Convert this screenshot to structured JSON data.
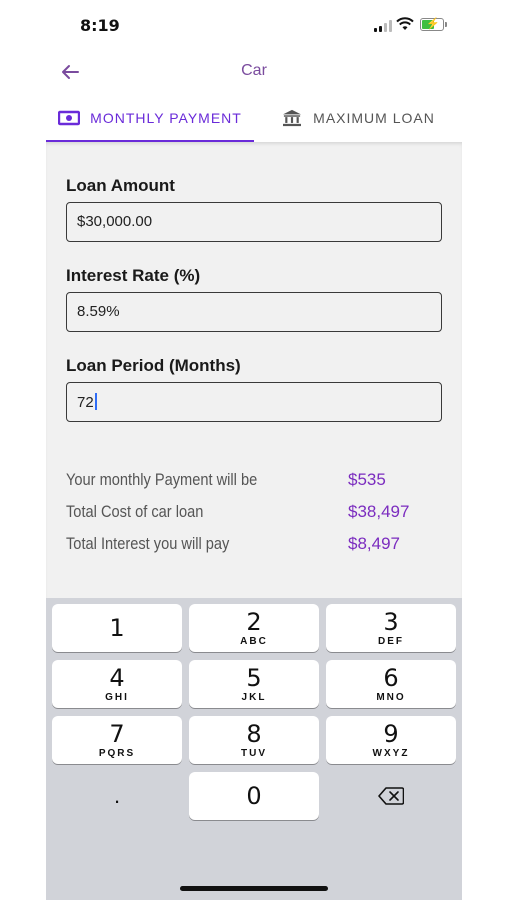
{
  "status": {
    "time": "8:19"
  },
  "nav": {
    "title": "Car"
  },
  "tabs": [
    {
      "label": "MONTHLY PAYMENT",
      "icon": "cash-icon",
      "active": true
    },
    {
      "label": "MAXIMUM LOAN",
      "icon": "bank-icon",
      "active": false
    }
  ],
  "form": {
    "loan_amount": {
      "label": "Loan Amount",
      "value": "$30,000.00"
    },
    "interest_rate": {
      "label": "Interest Rate (%)",
      "value": "8.59%"
    },
    "loan_period": {
      "label": "Loan Period (Months)",
      "value": "72"
    }
  },
  "results": [
    {
      "label": "Your monthly Payment will be",
      "value": "$535"
    },
    {
      "label": "Total Cost of car loan",
      "value": "$38,497"
    },
    {
      "label": "Total Interest you will pay",
      "value": "$8,497"
    }
  ],
  "keypad": {
    "keys": [
      {
        "num": "1",
        "letters": ""
      },
      {
        "num": "2",
        "letters": "ABC"
      },
      {
        "num": "3",
        "letters": "DEF"
      },
      {
        "num": "4",
        "letters": "GHI"
      },
      {
        "num": "5",
        "letters": "JKL"
      },
      {
        "num": "6",
        "letters": "MNO"
      },
      {
        "num": "7",
        "letters": "PQRS"
      },
      {
        "num": "8",
        "letters": "TUV"
      },
      {
        "num": "9",
        "letters": "WXYZ"
      },
      {
        "num": "0",
        "letters": ""
      }
    ],
    "decimal": "."
  },
  "colors": {
    "accent": "#6a2bd9",
    "result_value": "#7b2cbf",
    "nav_title": "#7a4b9e"
  }
}
